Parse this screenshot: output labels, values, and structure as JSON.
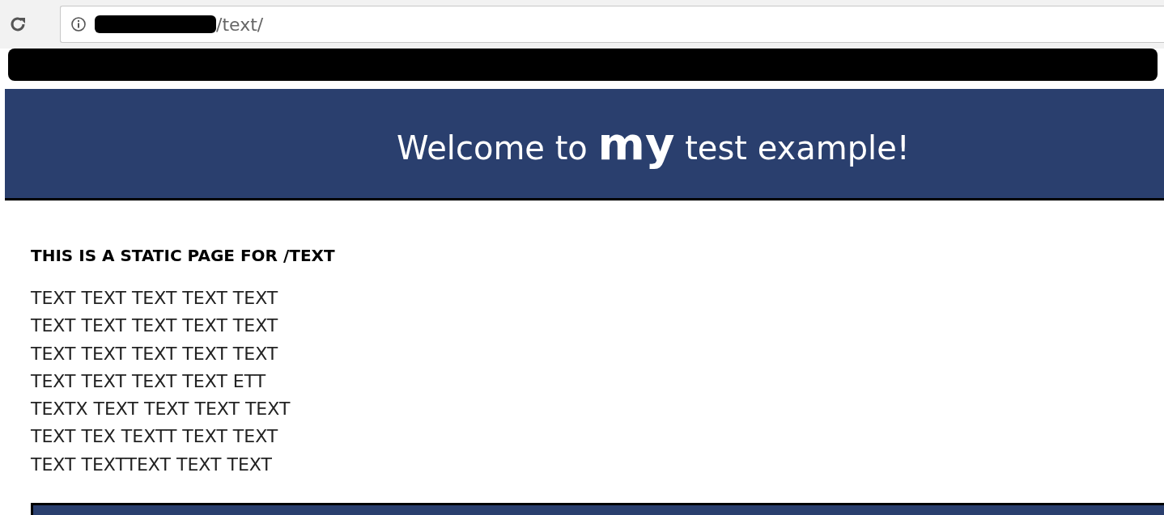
{
  "browser": {
    "url": "/text/"
  },
  "header": {
    "title": "Welcome to **my** test example!"
  },
  "content": {
    "heading": "THIS IS A STATIC PAGE FOR /TEXT",
    "lines": [
      "TEXT TEXT TEXT TEXT TEXT",
      "TEXT TEXT TEXT TEXT TEXT",
      "TEXT TEXT TEXT TEXT TEXT",
      "TEXT TEXT TEXT TEXT ETT",
      "TEXTX TEXT TEXT TEXT TEXT",
      "TEXT TEX TEXTT TEXT TEXT",
      "TEXT TEXTTEXT TEXT TEXT"
    ]
  }
}
